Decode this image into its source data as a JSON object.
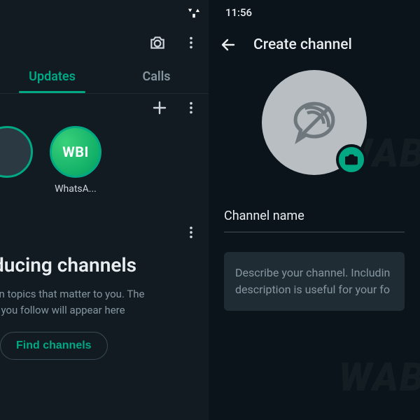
{
  "left": {
    "statusbar": {
      "time_placeholder": ""
    },
    "tabs": {
      "updates": "Updates",
      "calls": "Calls"
    },
    "stories": [
      {
        "label": "",
        "kind": "partial"
      },
      {
        "label": "WhatsA...",
        "kind": "wbi",
        "badge": "WBI"
      }
    ],
    "channels": {
      "title": "ducing channels",
      "desc_line1": "on topics that matter to you. The",
      "desc_line2": "s you follow will appear here",
      "find_label": "Find channels"
    }
  },
  "right": {
    "statusbar": {
      "time": "11:56"
    },
    "appbar": {
      "title": "Create channel"
    },
    "name_field": {
      "label": "Channel name"
    },
    "description": {
      "placeholder_line1": "Describe your channel. Includin",
      "placeholder_line2": "description is useful for your fo"
    }
  },
  "watermark": "WAB"
}
